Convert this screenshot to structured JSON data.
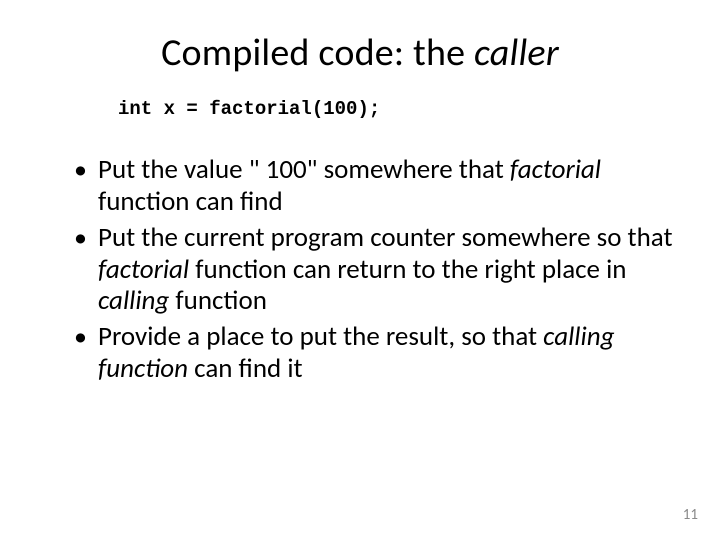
{
  "title": {
    "plain1": "Compiled code: the ",
    "italic": "caller"
  },
  "code": "int x = factorial(100);",
  "bullets": [
    {
      "t1": "Put the value \" 100\" somewhere that ",
      "i1": "factorial",
      "t2": " function can find"
    },
    {
      "t1": "Put the current program counter somewhere so that ",
      "i1": "factorial",
      "t2": " function can return to the right place in ",
      "i2": "calling",
      "t3": " function"
    },
    {
      "t1": "Provide a place to put the result, so that ",
      "i1": "calling function",
      "t2": " can find it"
    }
  ],
  "page_number": "11"
}
